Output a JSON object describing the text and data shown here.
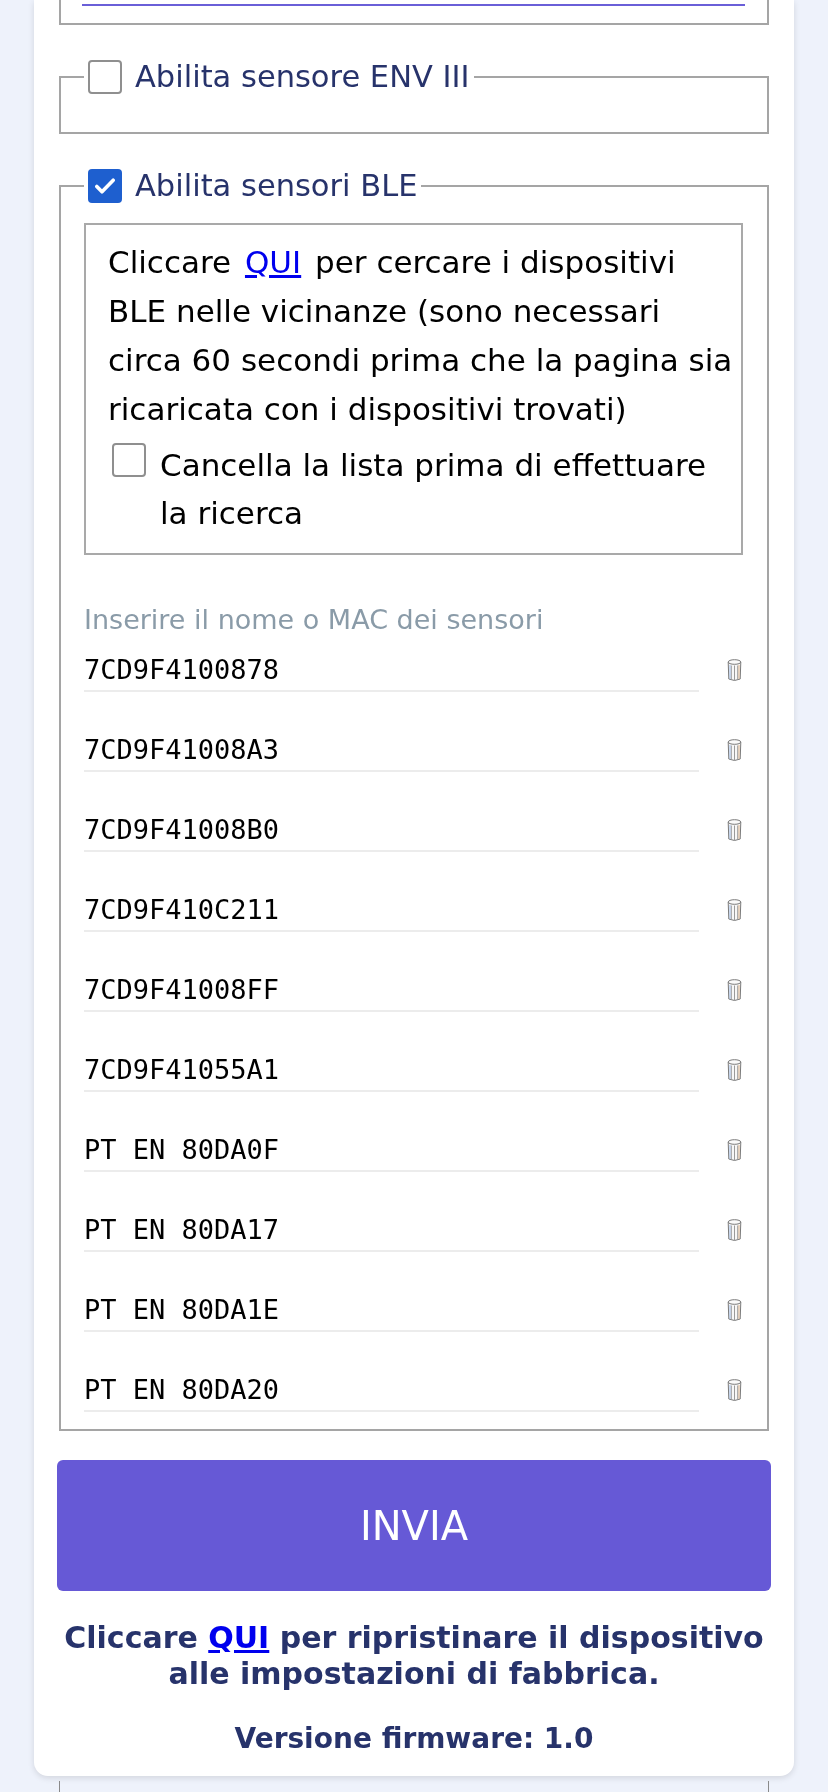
{
  "env_sensor": {
    "label": "Abilita sensore ENV III",
    "checked": false
  },
  "ble_sensors": {
    "label": "Abilita sensori BLE",
    "checked": true,
    "scan_info": {
      "text_before": "Cliccare ",
      "link": "QUI",
      "text_after": " per cercare i dispositivi BLE nelle vicinanze (sono necessari circa 60 secondi prima che la pagina sia ricaricata con i dispositivi trovati)"
    },
    "clear_list": {
      "label": "Cancella la lista prima di effettuare la ricerca",
      "checked": false
    },
    "sensors_label": "Inserire il nome o MAC dei sensori",
    "sensors": [
      {
        "value": "7CD9F4100878"
      },
      {
        "value": "7CD9F41008A3"
      },
      {
        "value": "7CD9F41008B0"
      },
      {
        "value": "7CD9F410C211"
      },
      {
        "value": "7CD9F41008FF"
      },
      {
        "value": "7CD9F41055A1"
      },
      {
        "value": "PT EN 80DA0F"
      },
      {
        "value": "PT EN 80DA17"
      },
      {
        "value": "PT EN 80DA1E"
      },
      {
        "value": "PT EN 80DA20"
      }
    ]
  },
  "submit_button": "INVIA",
  "factory_reset": {
    "text_before": "Cliccare ",
    "link": "QUI",
    "text_after": " per ripristinare il dispositivo alle impostazioni di fabbrica."
  },
  "firmware_version": "Versione firmware: 1.0"
}
